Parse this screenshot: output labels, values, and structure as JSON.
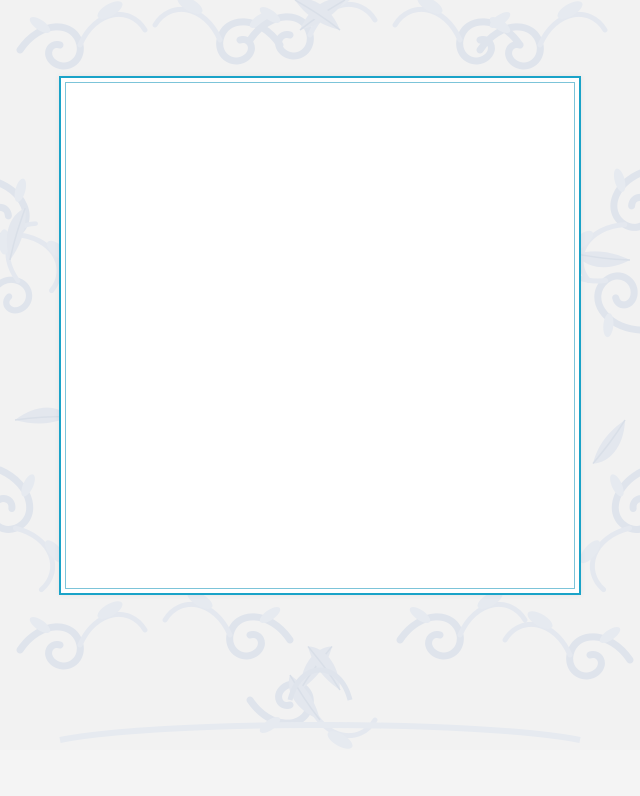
{
  "colors": {
    "page_background": "#f2f2f2",
    "ornament": "#dfe4ec",
    "card_background": "#ffffff",
    "card_border": "#1aa3c8",
    "card_inner_border": "#7cc4d9"
  },
  "ornament_icon": "damask-ornament-icon"
}
